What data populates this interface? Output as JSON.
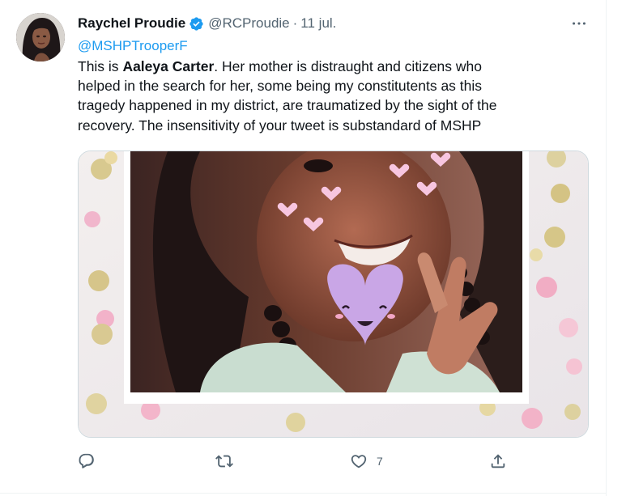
{
  "tweet": {
    "author_name": "Raychel Proudie",
    "author_handle": "@RCProudie",
    "separator": "·",
    "date": "11 jul.",
    "reply_to": "@MSHPTrooperF",
    "text_lines": [
      {
        "before": "This is ",
        "bold": "Aaleya Carter",
        "after": ". Her mother is distraught and citizens who"
      },
      {
        "before": "helped in the search for her, some being my constitutents as this",
        "bold": "",
        "after": ""
      },
      {
        "before": "tragedy happened in my district, are traumatized by the sight of the",
        "bold": "",
        "after": ""
      },
      {
        "before": "recovery. The insensitivity of your  tweet is substandard of MSHP",
        "bold": "",
        "after": ""
      }
    ],
    "media": {
      "description_icon": "photo-of-girl-with-heart-stickers"
    }
  },
  "actions": {
    "reply": {
      "icon": "reply-icon",
      "count": ""
    },
    "retweet": {
      "icon": "retweet-icon",
      "count": ""
    },
    "like": {
      "icon": "heart-icon",
      "count": "7"
    },
    "share": {
      "icon": "share-icon",
      "count": ""
    }
  },
  "colors": {
    "link": "#1d9bf0",
    "text": "#0f1419",
    "muted": "#536471",
    "verified": "#1d9bf0",
    "border": "#cfd9de"
  }
}
